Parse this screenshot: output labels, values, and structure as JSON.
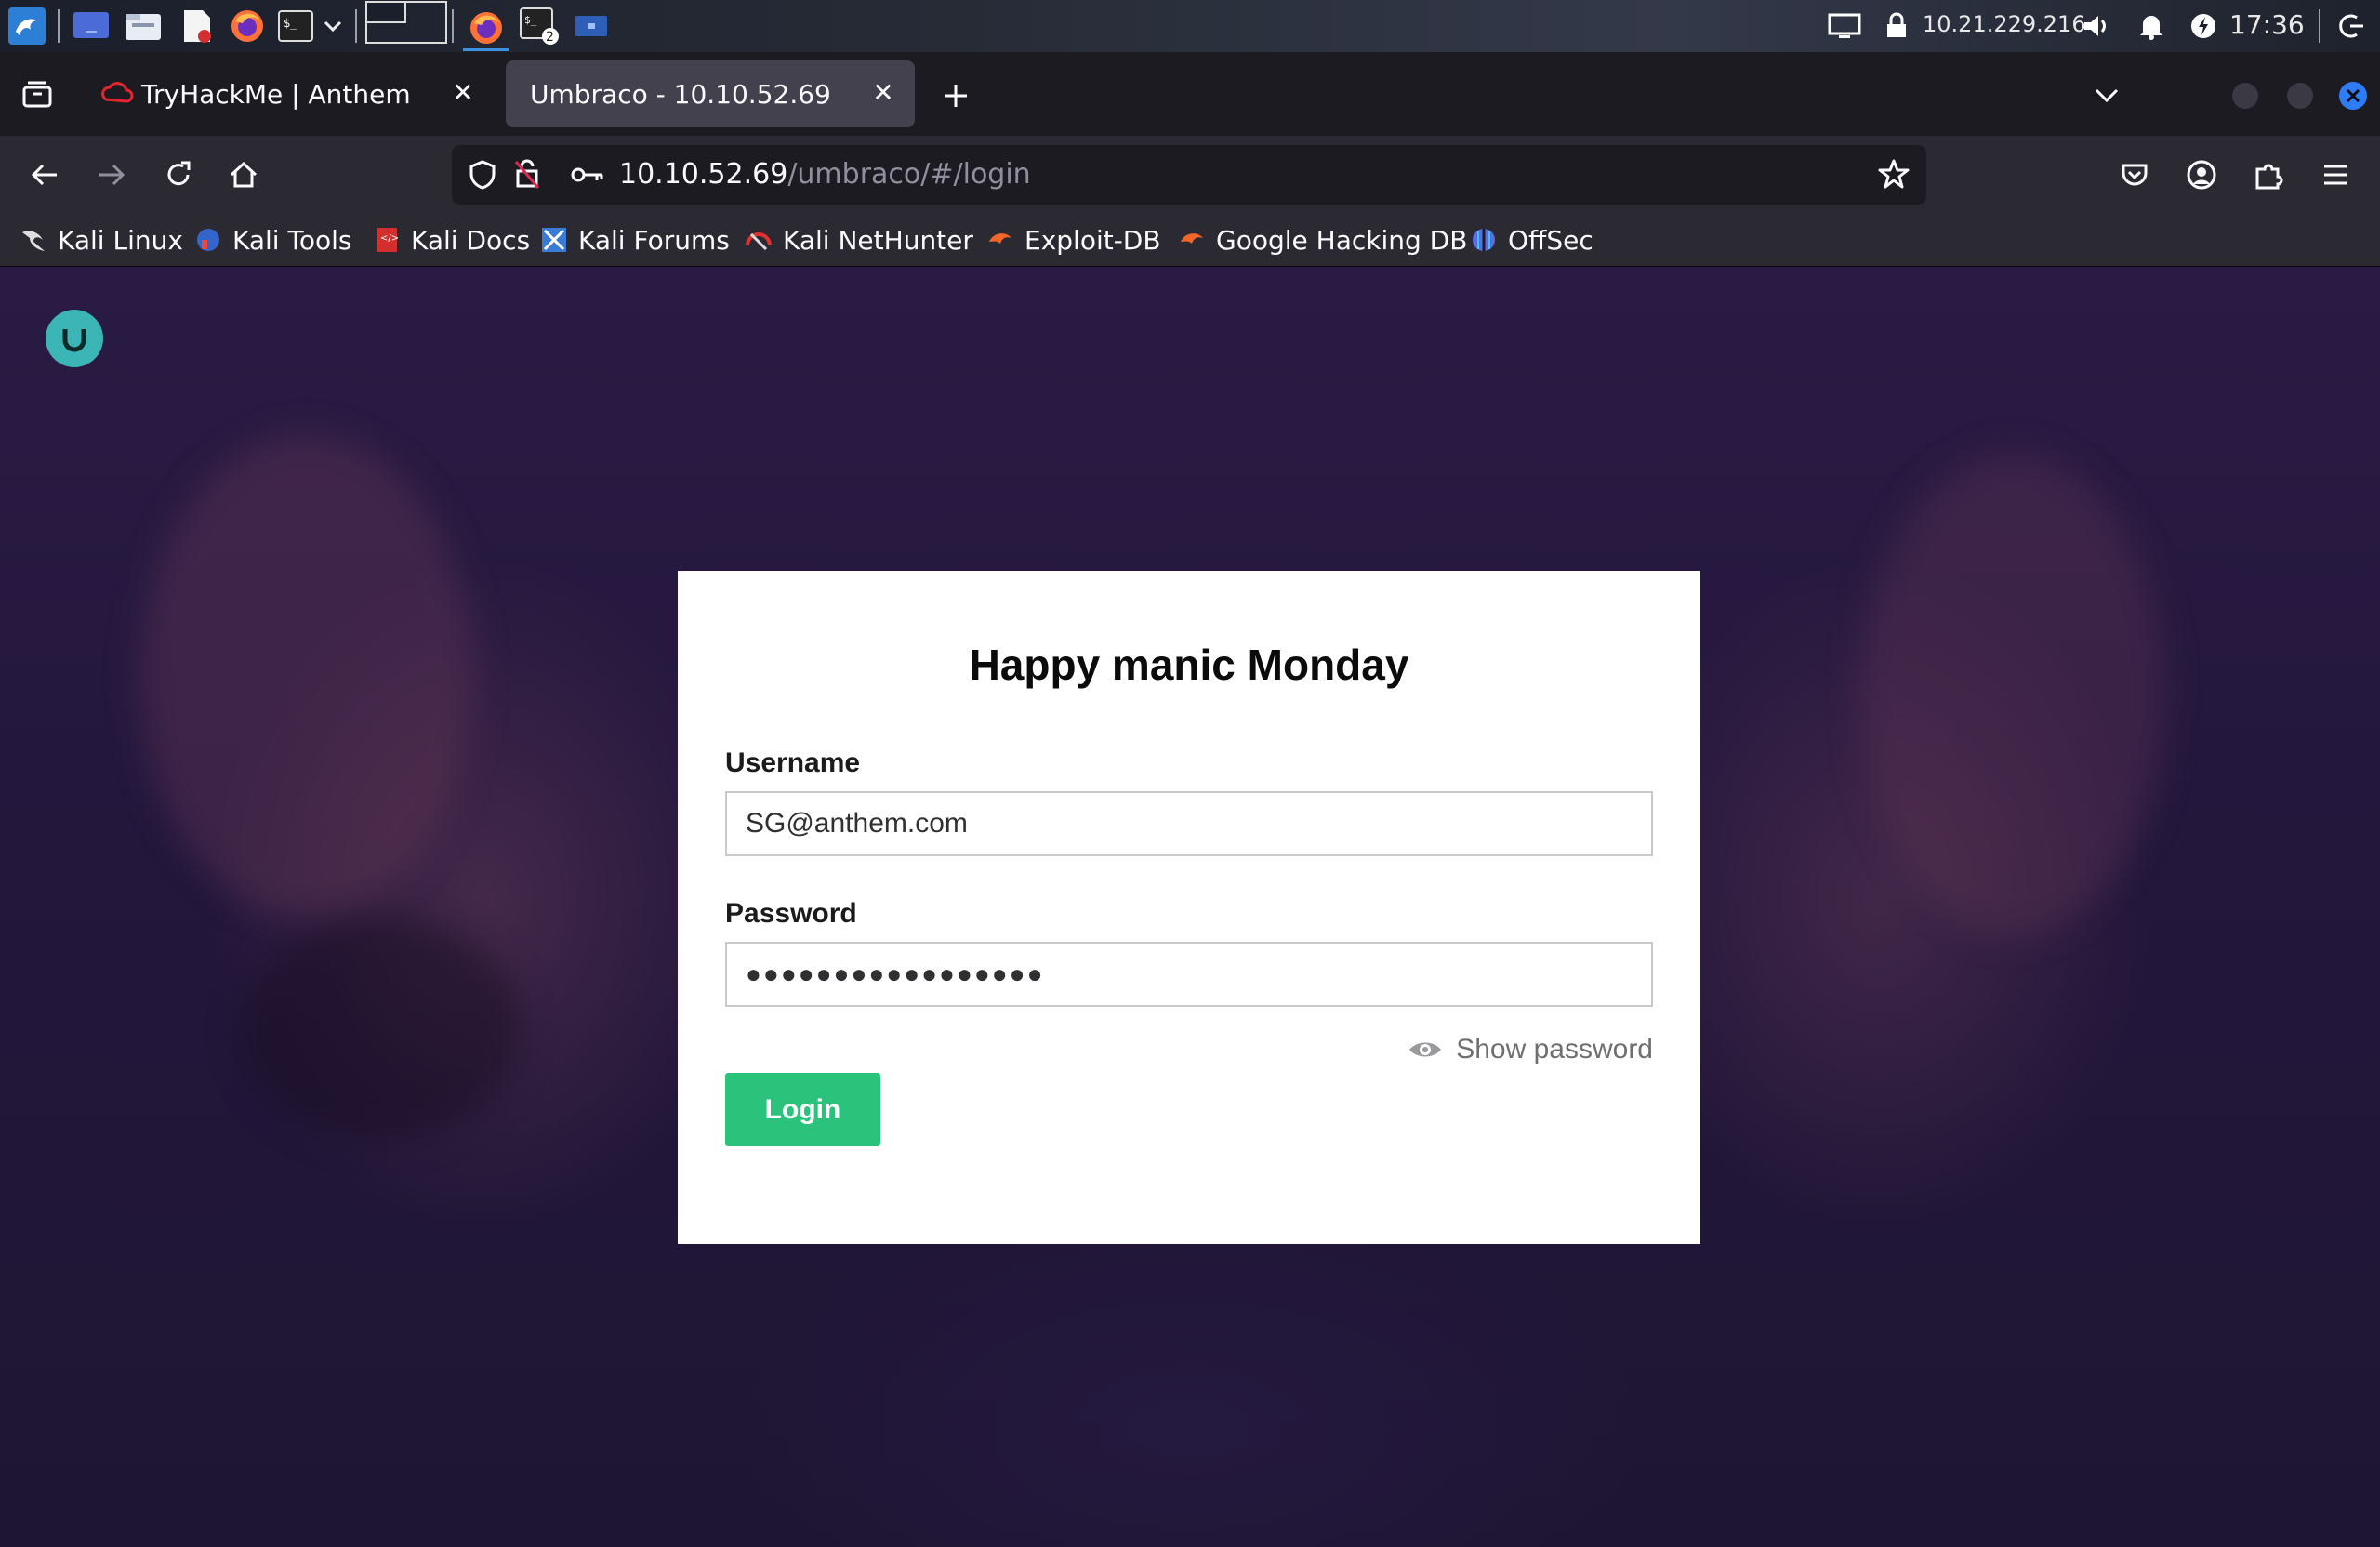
{
  "panel": {
    "ip": "10.21.229.216",
    "clock": "17:36",
    "badge": "2"
  },
  "tabs": [
    {
      "title": "TryHackMe | Anthem",
      "active": false
    },
    {
      "title": "Umbraco - 10.10.52.69",
      "active": true
    }
  ],
  "toolbar": {
    "url_host": "10.10.52.69",
    "url_path": "/umbraco/#/login"
  },
  "bookmarks": [
    {
      "label": "Kali Linux",
      "icon": "kali-dragon-icon"
    },
    {
      "label": "Kali Tools",
      "icon": "kali-tools-icon"
    },
    {
      "label": "Kali Docs",
      "icon": "kali-docs-icon"
    },
    {
      "label": "Kali Forums",
      "icon": "kali-forums-icon"
    },
    {
      "label": "Kali NetHunter",
      "icon": "nethunter-icon"
    },
    {
      "label": "Exploit-DB",
      "icon": "exploit-db-icon"
    },
    {
      "label": "Google Hacking DB",
      "icon": "ghdb-icon"
    },
    {
      "label": "OffSec",
      "icon": "offsec-icon"
    }
  ],
  "login": {
    "title": "Happy manic Monday",
    "username_label": "Username",
    "username_value": "SG@anthem.com",
    "password_label": "Password",
    "password_mask": "●●●●●●●●●●●●●●●●●",
    "show_password": "Show password",
    "login_button": "Login"
  },
  "colors": {
    "login_button": "#2bc37c",
    "umbraco_logo": "#3bb5b5",
    "page_background": "#24173d"
  }
}
